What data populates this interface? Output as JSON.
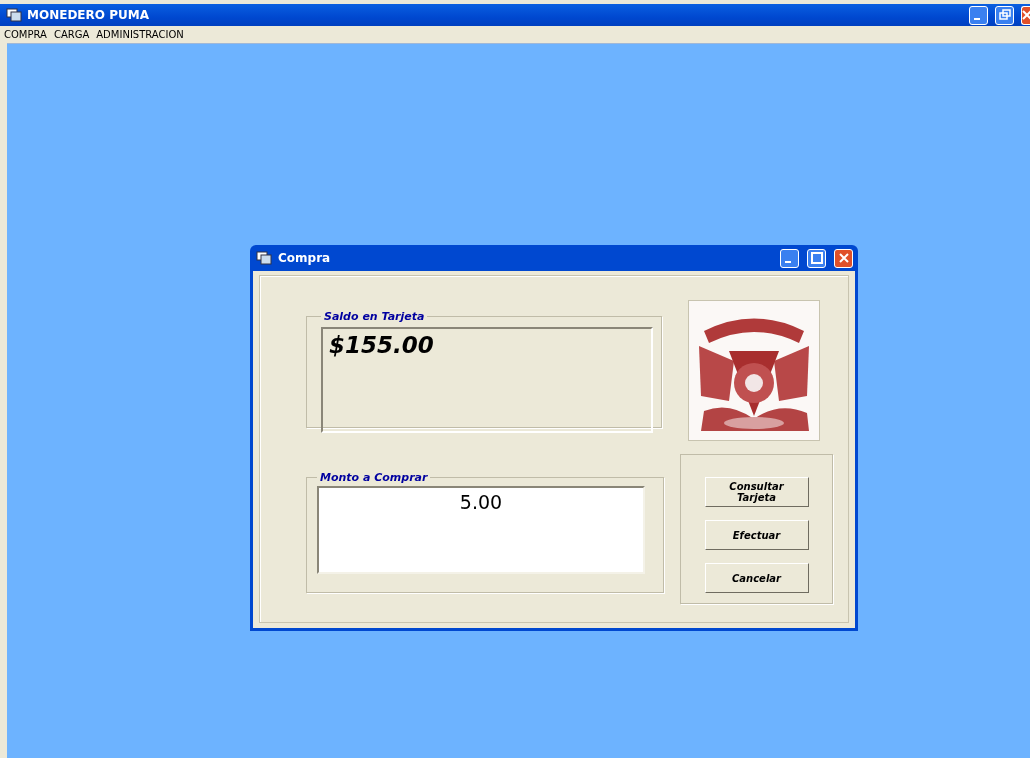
{
  "window": {
    "title": "MONEDERO PUMA"
  },
  "menu": [
    "COMPRA",
    "CARGA",
    "ADMINISTRACION"
  ],
  "dialog": {
    "title": "Compra",
    "balance": {
      "legend": "Saldo en Tarjeta",
      "value": "$155.00"
    },
    "amount": {
      "legend": "Monto a Comprar",
      "value": "5.00"
    },
    "buttons": [
      "Consultar Tarjeta",
      "Efectuar",
      "Cancelar"
    ]
  }
}
